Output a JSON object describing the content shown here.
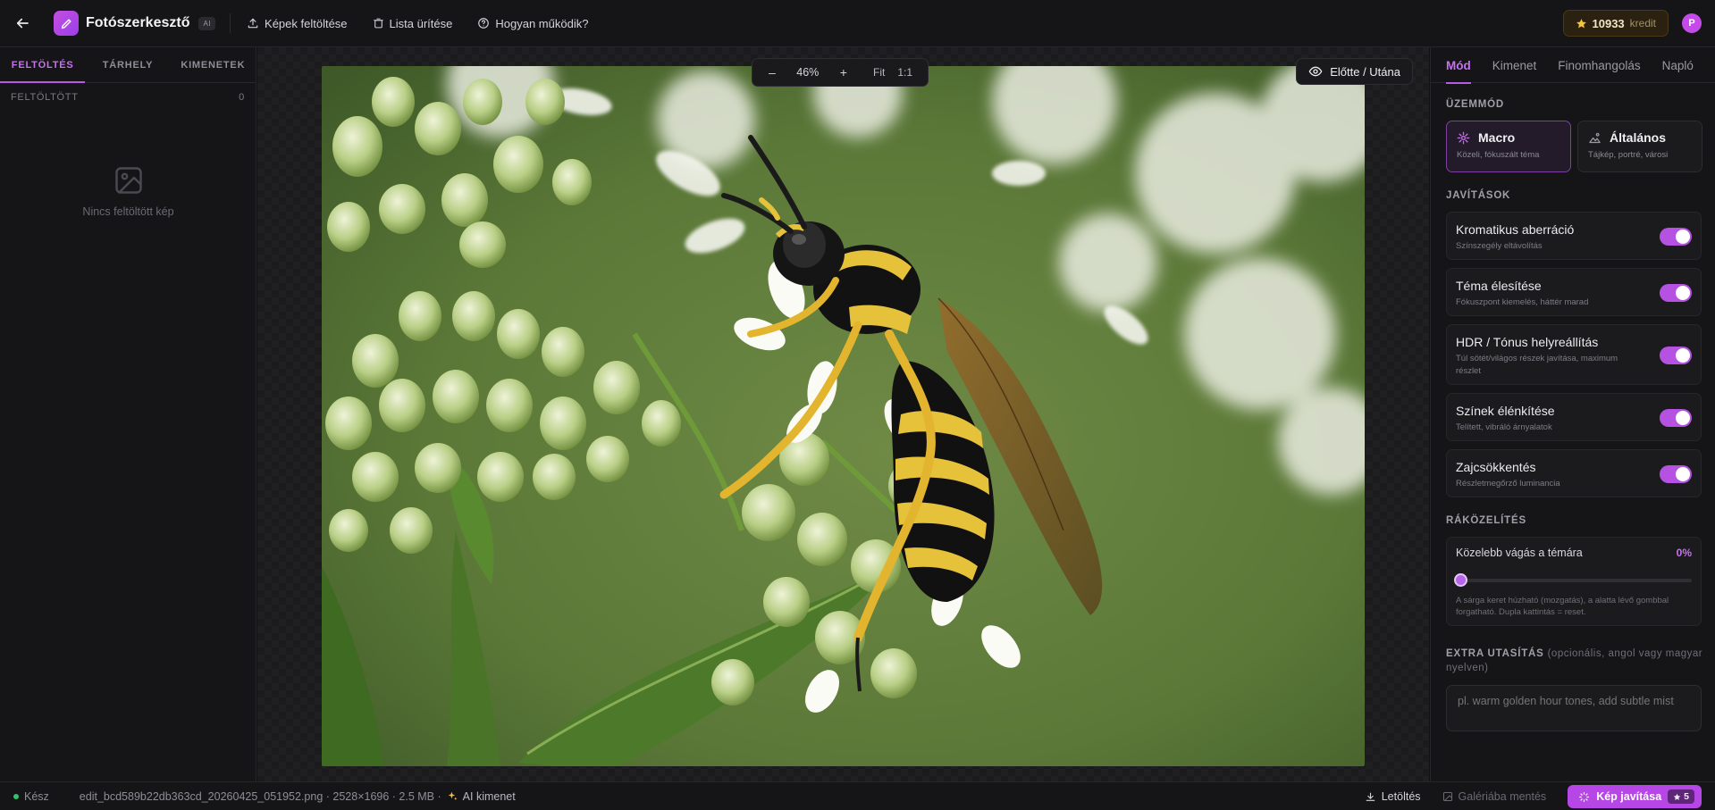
{
  "header": {
    "app_title": "Fotószerkesztő",
    "badge": "AI",
    "links": [
      {
        "label": "Képek feltöltése",
        "icon": "upload-icon"
      },
      {
        "label": "Lista ürítése",
        "icon": "trash-icon"
      },
      {
        "label": "Hogyan működik?",
        "icon": "help-circle-icon"
      }
    ],
    "credits": {
      "value": "10933",
      "unit": "kredit",
      "icon": "star-icon",
      "color": "#f5c242"
    },
    "avatar_initial": "P"
  },
  "left": {
    "tabs": [
      "FELTÖLTÉS",
      "TÁRHELY",
      "KIMENETEK"
    ],
    "active_tab": 0,
    "uploaded_label": "FELTÖLTÖTT",
    "uploaded_count": "0",
    "empty_text": "Nincs feltöltött kép"
  },
  "canvas": {
    "zoom": {
      "minus": "–",
      "value": "46%",
      "plus": "+",
      "fit": "Fit",
      "one_to_one": "1:1"
    },
    "before_after_label": "Előtte / Utána",
    "image_subject": "wasp-on-white-flowers-macro-photo"
  },
  "right": {
    "tabs": [
      "Mód",
      "Kimenet",
      "Finomhangolás",
      "Napló"
    ],
    "active_tab": 0,
    "mode_section": "ÜZEMMÓD",
    "modes": [
      {
        "title": "Macro",
        "subtitle": "Közeli, fókuszált téma",
        "icon": "sparkle-icon",
        "active": true
      },
      {
        "title": "Általános",
        "subtitle": "Tájkép, portré, városi",
        "icon": "landscape-icon",
        "active": false
      }
    ],
    "fixes_section": "JAVÍTÁSOK",
    "fixes": [
      {
        "title": "Kromatikus aberráció",
        "desc": "Színszegély eltávolítás",
        "on": true
      },
      {
        "title": "Téma élesítése",
        "desc": "Fókuszpont kiemelés, háttér marad",
        "on": true
      },
      {
        "title": "HDR / Tónus helyreállítás",
        "desc": "Túl sötét/világos részek javítása, maximum részlet",
        "on": true
      },
      {
        "title": "Színek élénkítése",
        "desc": "Telített, vibráló árnyalatok",
        "on": true
      },
      {
        "title": "Zajcsökkentés",
        "desc": "Részletmegőrző luminancia",
        "on": true
      }
    ],
    "zoom_section": "RÁKÖZELÍTÉS",
    "zoom_card": {
      "title": "Közelebb vágás a témára",
      "value": "0%",
      "level": 0,
      "note": "A sárga keret húzható (mozgatás), a alatta lévő gombbal forgatható. Dupla kattintás = reset."
    },
    "extra": {
      "label": "EXTRA UTASÍTÁS",
      "optional": "(opcionális, angol vagy magyar nyelven)",
      "placeholder": "pl. warm golden hour tones, add subtle mist"
    }
  },
  "status": {
    "ready": "Kész",
    "file_info": "edit_bcd589b22db363cd_20260425_051952.png · 2528×1696 · 2.5 MB ·",
    "ai_label": "AI kimenet",
    "download": "Letöltés",
    "save_gallery": "Galériába mentés",
    "improve": "Kép javítása",
    "cost": "5"
  },
  "colors": {
    "accent": "#b65ae8",
    "background": "#111113",
    "success": "#32c26a"
  }
}
